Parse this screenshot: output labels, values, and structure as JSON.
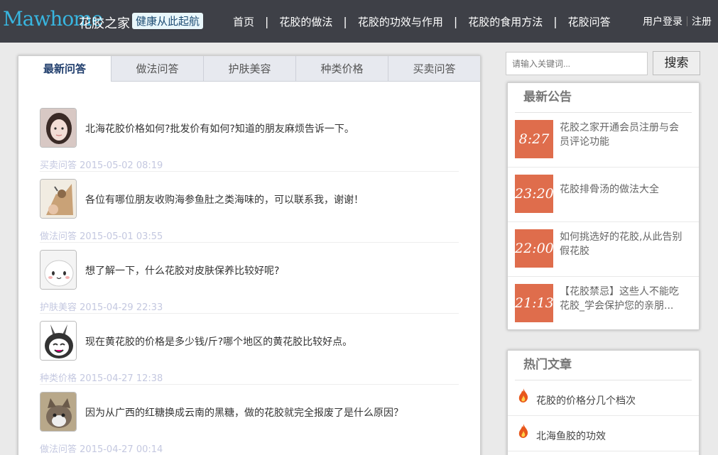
{
  "header": {
    "logo_text": "Mawhome",
    "logo_cn": "花胶之家",
    "slogan": "健康从此起航",
    "nav": [
      "首页",
      "花胶的做法",
      "花胶的功效与作用",
      "花胶的食用方法",
      "花胶问答"
    ],
    "login": "用户登录",
    "register": "注册"
  },
  "tabs": [
    "最新问答",
    "做法问答",
    "护肤美容",
    "种类价格",
    "买卖问答"
  ],
  "questions": [
    {
      "title": "北海花胶价格如何?批发价有如何?知道的朋友麻烦告诉一下。",
      "category": "买卖问答",
      "time": "2015-05-02 08:19"
    },
    {
      "title": "各位有哪位朋友收购海参鱼肚之类海味的，可以联系我，谢谢！",
      "category": "做法问答",
      "time": "2015-05-01 03:55"
    },
    {
      "title": "想了解一下，什么花胶对皮肤保养比较好呢?",
      "category": "护肤美容",
      "time": "2015-04-29 22:33"
    },
    {
      "title": "现在黄花胶的价格是多少钱/斤?哪个地区的黄花胶比较好点。",
      "category": "种类价格",
      "time": "2015-04-27 12:38"
    },
    {
      "title": "因为从广西的红糖换成云南的黑糖，做的花胶就完全报废了是什么原因？",
      "category": "做法问答",
      "time": "2015-04-27 00:14"
    }
  ],
  "search": {
    "placeholder": "请输入关键词...",
    "button": "搜索"
  },
  "notices": {
    "title": "最新公告",
    "items": [
      {
        "time": "8:27",
        "text": "花胶之家开通会员注册与会员评论功能"
      },
      {
        "time": "23:20",
        "text": "花胶排骨汤的做法大全"
      },
      {
        "time": "22:00",
        "text": "如何挑选好的花胶,从此告别假花胶"
      },
      {
        "time": "21:13",
        "text": "【花胶禁忌】这些人不能吃花胶_学会保护您的亲朋..."
      }
    ]
  },
  "hot": {
    "title": "热门文章",
    "items": [
      "花胶的价格分几个档次",
      "北海鱼胶的功效"
    ]
  },
  "colors": {
    "header_bg": "#3e4047",
    "accent": "#df6d4c",
    "logo": "#38b5df",
    "meta": "#c4c8e0"
  }
}
